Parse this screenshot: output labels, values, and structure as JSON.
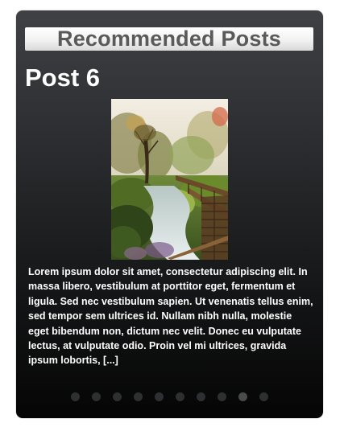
{
  "widget": {
    "title": "Recommended Posts"
  },
  "post": {
    "title": "Post 6",
    "image_alt": "forest landscape with wooden walkway and stream",
    "excerpt": "Lorem ipsum dolor sit amet, consectetur adipiscing elit. In massa libero, vestibulum at porttitor eget, fermentum et ligula. Sed nec vestibulum sapien. Ut venenatis tellus enim, sed tempor sem ultrices id. Nullam nibh nulla, molestie eget bibendum non, dictum nec velit. Donec eu vulputate lectus, at vulputate odio. Proin vel mi ultrices, gravida ipsum lobortis, [...]"
  },
  "pager": {
    "total": 10,
    "active_index": 8
  },
  "colors": {
    "widget_background": "#2a2b2e",
    "header_bar": "#f2f2f2",
    "header_text": "#5a5a5a",
    "body_text": "#ffffff",
    "dot": "#2e2f31",
    "dot_active": "#4a4b4d"
  }
}
